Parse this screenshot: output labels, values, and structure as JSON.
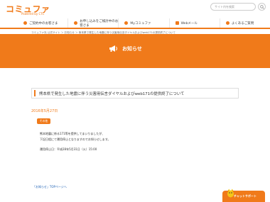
{
  "header": {
    "logo_text": "コミュファ",
    "logo_sub": "Powered by CTC",
    "search_placeholder": "サイト内を検索"
  },
  "gnav": {
    "items": [
      {
        "label": "ご契約中のお客さま"
      },
      {
        "label": "お申し込みをご検討中のお客さま"
      },
      {
        "label": "Myコミュファ"
      },
      {
        "label": "Webメール"
      },
      {
        "label": "よくあるご質問"
      }
    ]
  },
  "breadcrumb": "コミュファ光 公式サイト ＞ お知らせ ＞ 熊本県で発生した地震に伴う災害用伝言ダイヤルおよびweb171の提供終了について",
  "hero": {
    "title": "お知らせ"
  },
  "article": {
    "title": "熊本県で発生した地震に伴う災害用伝言ダイヤルおよびweb171の提供終了について",
    "date": "2016年5月27日",
    "category": "その他",
    "body": [
      "熊本地震に係る171等を提供してまいりましたが、",
      "下記日程にて運用停止となりますのでお知らせします。",
      "運用停止日：平成28年5月31日（火）15:00"
    ]
  },
  "footer": {
    "back_link": "「お知らせ」TOPページへ"
  },
  "chat": {
    "label": "チャットサポート"
  },
  "colors": {
    "accent": "#f07a1a",
    "link": "#1a5fb4"
  }
}
